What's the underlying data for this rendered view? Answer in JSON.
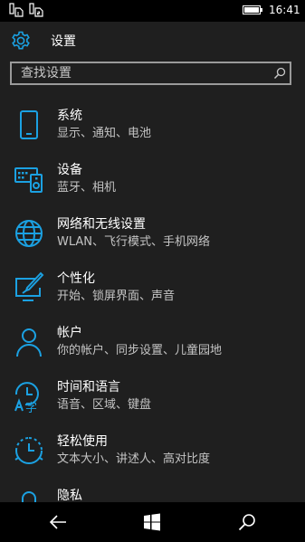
{
  "status_bar": {
    "time": "16:41",
    "sim1_icon": "sim-card-1-icon",
    "sim2_icon": "sim-card-2-icon",
    "battery_icon": "battery-full-icon"
  },
  "header": {
    "title": "设置",
    "icon": "gear-icon"
  },
  "search": {
    "placeholder": "查找设置",
    "value": ""
  },
  "accent_color": "#1ba1e2",
  "items": [
    {
      "title": "系统",
      "subtitle": "显示、通知、电池",
      "icon": "phone-icon"
    },
    {
      "title": "设备",
      "subtitle": "蓝牙、相机",
      "icon": "devices-icon"
    },
    {
      "title": "网络和无线设置",
      "subtitle": "WLAN、飞行模式、手机网络",
      "icon": "globe-icon"
    },
    {
      "title": "个性化",
      "subtitle": "开始、锁屏界面、声音",
      "icon": "personalize-icon"
    },
    {
      "title": "帐户",
      "subtitle": "你的帐户、同步设置、儿童园地",
      "icon": "person-icon"
    },
    {
      "title": "时间和语言",
      "subtitle": "语音、区域、键盘",
      "icon": "time-language-icon"
    },
    {
      "title": "轻松使用",
      "subtitle": "文本大小、讲述人、高对比度",
      "icon": "ease-of-access-icon"
    },
    {
      "title": "隐私",
      "subtitle": "",
      "icon": "lock-icon"
    }
  ],
  "nav_bar": {
    "back_icon": "back-arrow-icon",
    "start_icon": "windows-logo-icon",
    "search_icon": "search-icon"
  }
}
